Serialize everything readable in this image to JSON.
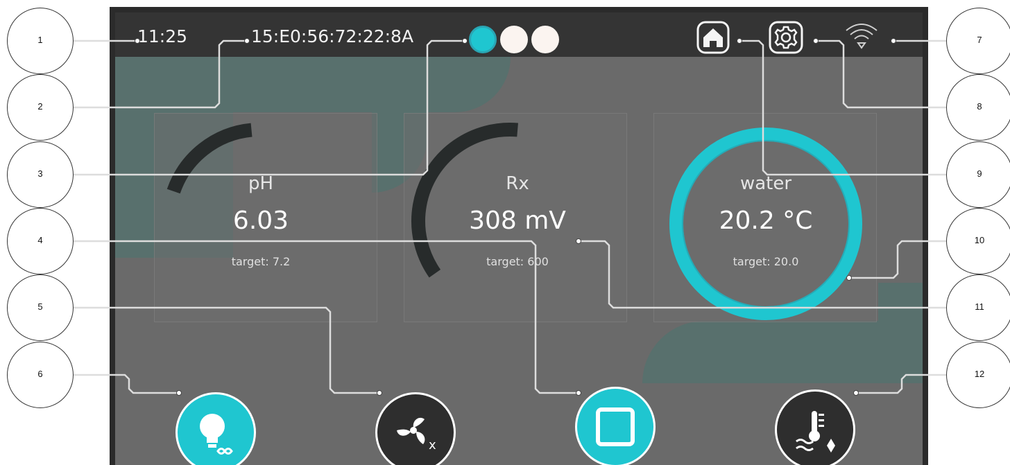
{
  "status_bar": {
    "time": "11:25",
    "mac_address": "15:E0:56:72:22:8A",
    "page_dots": [
      "active",
      "inactive",
      "inactive"
    ]
  },
  "gauges": [
    {
      "label": "pH",
      "value": "6.03",
      "target": "target: 7.2",
      "fill_fraction": 0.18
    },
    {
      "label": "Rx",
      "value": "308 mV",
      "target": "target: 600",
      "fill_fraction": 0.36
    },
    {
      "label": "water",
      "value": "20.2 °C",
      "target": "target: 20.0",
      "fill_fraction": 1.0
    }
  ],
  "icons": {
    "home": "home-icon",
    "settings": "gear-icon",
    "wifi": "wifi-icon",
    "light": "light-bulb-infinity-icon",
    "fan": "fan-off-icon",
    "stop": "square-stop-icon",
    "heater": "water-thermometer-icon"
  },
  "callouts": [
    "1",
    "2",
    "3",
    "4",
    "5",
    "6",
    "7",
    "8",
    "9",
    "10",
    "11",
    "12"
  ],
  "colors": {
    "accent": "#1fc6d0",
    "screen_bg": "#6a6a6a",
    "topbar_bg": "#343434",
    "bg_shape": "#58706d",
    "gauge_track": "#272b2b"
  }
}
